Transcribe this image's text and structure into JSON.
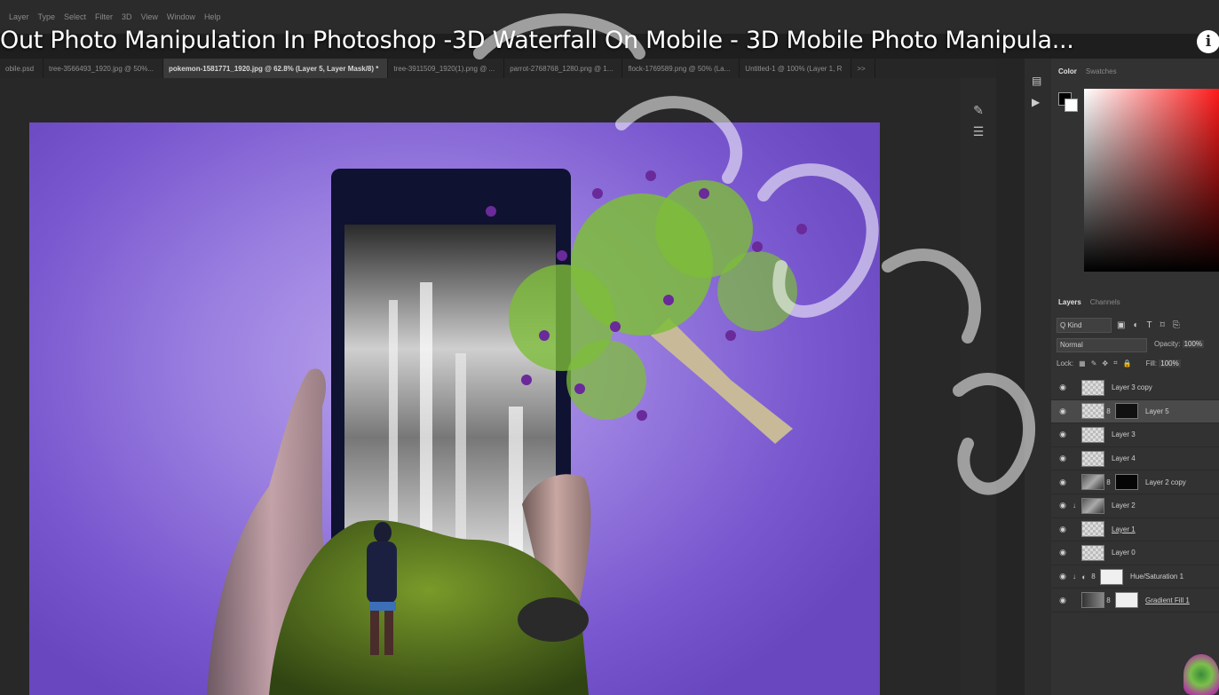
{
  "menu": [
    "Layer",
    "Type",
    "Select",
    "Filter",
    "3D",
    "View",
    "Window",
    "Help"
  ],
  "video_title": "Out Photo Manipulation In Photoshop -3D Waterfall On Mobile - 3D Mobile Photo Manipula...",
  "tabs": [
    {
      "label": "obile.psd",
      "active": false
    },
    {
      "label": "tree-3566493_1920.jpg @ 50%...",
      "active": false
    },
    {
      "label": "pokemon-1581771_1920.jpg @ 62.8% (Layer 5, Layer Mask/8) *",
      "active": true
    },
    {
      "label": "tree-3911509_1920(1).png @ ...",
      "active": false
    },
    {
      "label": "parrot-2768768_1280.png @ 1...",
      "active": false
    },
    {
      "label": "flock-1769589.png @ 50% (La...",
      "active": false
    },
    {
      "label": "Untitled-1 @ 100% (Layer 1, R",
      "active": false
    }
  ],
  "tabs_overflow": ">>",
  "color_panel": {
    "tabs": [
      "Color",
      "Swatches"
    ],
    "foreground": "#000000",
    "background": "#ffffff",
    "hue_color": "#ff1a1a"
  },
  "layers_panel": {
    "tabs": [
      "Layers",
      "Channels"
    ],
    "kind_label": "Q Kind",
    "blend_mode": "Normal",
    "opacity_label": "Opacity:",
    "opacity_value": "100%",
    "lock_label": "Lock:",
    "fill_label": "Fill:",
    "fill_value": "100%",
    "layers": [
      {
        "name": "Layer 3 copy",
        "thumb": "transparent",
        "selected": false
      },
      {
        "name": "Layer 5",
        "thumb": "transparent",
        "mask": true,
        "selected": true
      },
      {
        "name": "Layer 3",
        "thumb": "transparent",
        "selected": false
      },
      {
        "name": "Layer 4",
        "thumb": "transparent",
        "selected": false
      },
      {
        "name": "Layer 2 copy",
        "thumb": "photo",
        "mask": true,
        "selected": false
      },
      {
        "name": "Layer 2",
        "thumb": "photo",
        "clipped": true,
        "selected": false
      },
      {
        "name": "Layer 1",
        "thumb": "transparent",
        "underline": true,
        "selected": false
      },
      {
        "name": "Layer 0",
        "thumb": "transparent",
        "selected": false
      },
      {
        "name": "Hue/Saturation 1",
        "thumb": "white",
        "adjustment": true,
        "clipped": true,
        "selected": false
      },
      {
        "name": "Gradient Fill 1",
        "thumb": "grad",
        "underline": true,
        "selected": false
      }
    ]
  },
  "info_button": "i",
  "canvas_background": "#9a7fe0"
}
